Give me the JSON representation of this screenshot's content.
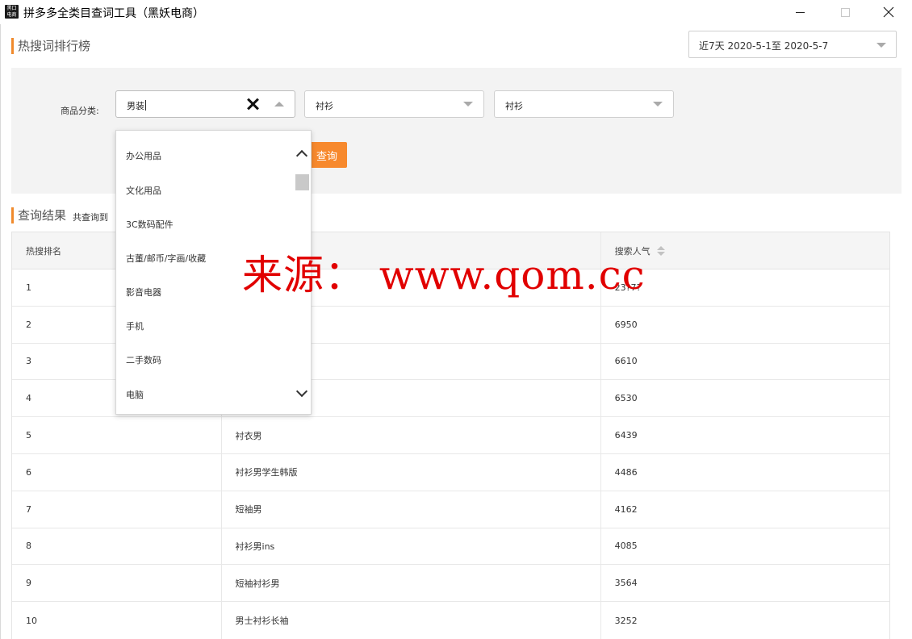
{
  "window": {
    "icon_text": "黑口\n电商",
    "title": "拼多多全类目查词工具（黑妖电商）"
  },
  "hot_section": {
    "title": "热搜词排行榜"
  },
  "date_range": {
    "selected": "近7天 2020-5-1至 2020-5-7"
  },
  "filter": {
    "label": "商品分类:",
    "category1_value": "男装",
    "category2_value": "衬衫",
    "category3_value": "衬衫",
    "query_button": "查询"
  },
  "dropdown": {
    "items": [
      "办公用品",
      "文化用品",
      "3C数码配件",
      "古董/邮币/字画/收藏",
      "影音电器",
      "手机",
      "二手数码",
      "电脑"
    ]
  },
  "results": {
    "title": "查询结果",
    "count_text": "共查询到",
    "columns": {
      "rank": "热搜排名",
      "keyword": "",
      "popularity": "搜索人气"
    },
    "rows": [
      {
        "rank": "1",
        "keyword": "",
        "popularity": "23?7?"
      },
      {
        "rank": "2",
        "keyword": "",
        "popularity": "6950"
      },
      {
        "rank": "3",
        "keyword": "",
        "popularity": "6610"
      },
      {
        "rank": "4",
        "keyword": "",
        "popularity": "6530"
      },
      {
        "rank": "5",
        "keyword": "衬衣男",
        "popularity": "6439"
      },
      {
        "rank": "6",
        "keyword": "衬衫男学生韩版",
        "popularity": "4486"
      },
      {
        "rank": "7",
        "keyword": "短袖男",
        "popularity": "4162"
      },
      {
        "rank": "8",
        "keyword": "衬衫男ins",
        "popularity": "4085"
      },
      {
        "rank": "9",
        "keyword": "短袖衬衫男",
        "popularity": "3564"
      },
      {
        "rank": "10",
        "keyword": "男士衬衫长袖",
        "popularity": "3252"
      }
    ]
  },
  "watermark": {
    "text": "来源： www.qom.cc"
  },
  "colors": {
    "accent": "#f7892d",
    "watermark": "#e10000"
  }
}
